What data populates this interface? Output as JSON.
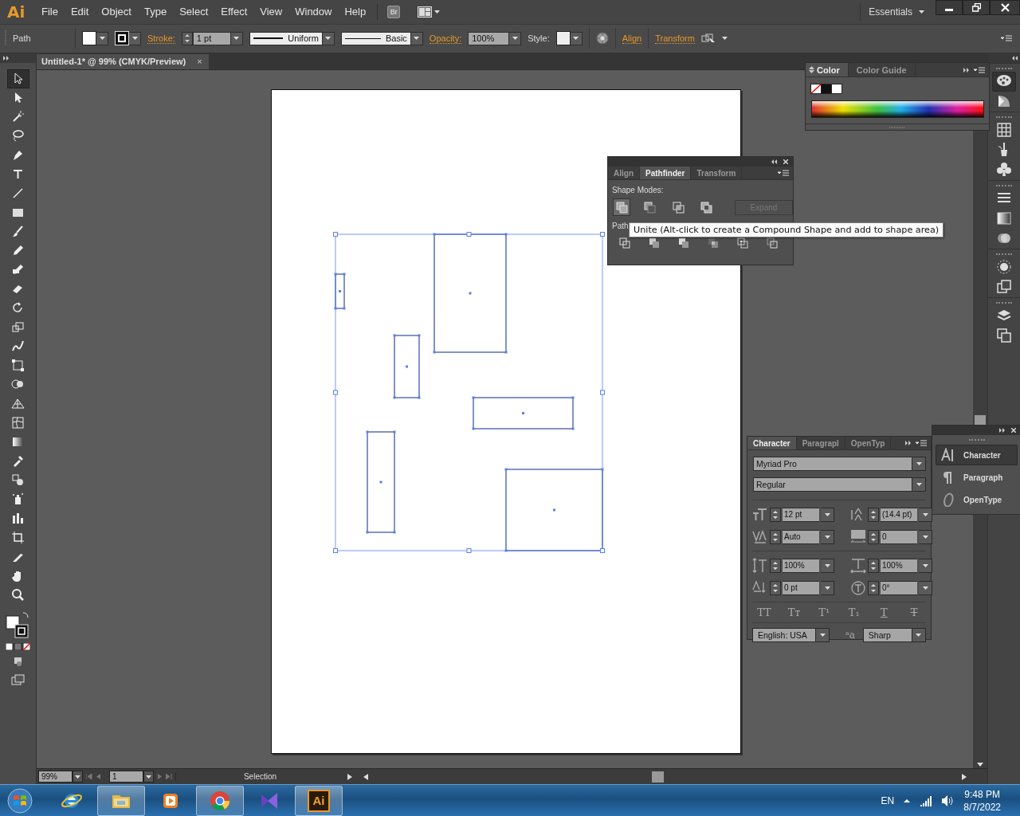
{
  "app": {
    "logo": "Ai",
    "menu": [
      "File",
      "Edit",
      "Object",
      "Type",
      "Select",
      "Effect",
      "View",
      "Window",
      "Help"
    ],
    "bridge": "Br",
    "workspace": "Essentials"
  },
  "control_bar": {
    "selection": "Path",
    "stroke_label": "Stroke:",
    "stroke_weight": "1 pt",
    "profile": "Uniform",
    "brush": "Basic",
    "opacity_label": "Opacity:",
    "opacity": "100%",
    "style_label": "Style:",
    "links": [
      "Align",
      "Transform"
    ]
  },
  "document_tab": {
    "title": "Untitled-1* @ 99% (CMYK/Preview)",
    "close": "×"
  },
  "color_panel": {
    "tabs": [
      {
        "label": "Color",
        "selected": true
      },
      {
        "label": "Color Guide",
        "selected": false
      }
    ]
  },
  "pathfinder_panel": {
    "tabs": [
      {
        "label": "Align",
        "selected": false
      },
      {
        "label": "Pathfinder",
        "selected": true
      },
      {
        "label": "Transform",
        "selected": false
      }
    ],
    "shape_modes_label": "Shape Modes:",
    "shape_modes": [
      {
        "hovered": true
      },
      {
        "hovered": false
      },
      {
        "hovered": false
      },
      {
        "hovered": false
      }
    ],
    "expand": {
      "label": "Expand",
      "disabled": true
    },
    "pathfinders_label": "Path",
    "tooltip": "Unite (Alt-click to create a Compound Shape and add to shape area)"
  },
  "character_panel": {
    "tabs": [
      {
        "label": "Character",
        "selected": true
      },
      {
        "label": "Paragrapl",
        "selected": false
      },
      {
        "label": "OpenTyp",
        "selected": false
      }
    ],
    "font": "Myriad Pro",
    "style": "Regular",
    "metrics": [
      {
        "value": "12 pt"
      },
      {
        "value": "(14.4 pt)"
      },
      {
        "value": "Auto"
      },
      {
        "value": "0"
      },
      {
        "value": "100%"
      },
      {
        "value": "100%"
      },
      {
        "value": "0 pt"
      },
      {
        "value": "0°"
      }
    ],
    "type_buttons": [
      {
        "label": "TT",
        "kind": "plain"
      },
      {
        "label": "Tᴛ",
        "kind": "plain"
      },
      {
        "label": "T¹",
        "kind": "plain"
      },
      {
        "label": "T₁",
        "kind": "plain"
      },
      {
        "label": "T",
        "kind": "underline"
      },
      {
        "label": "T",
        "kind": "strike"
      }
    ],
    "language": "English: USA",
    "antialias_glyph": "ᵃa",
    "antialias": "Sharp"
  },
  "panel_dock": {
    "items": [
      {
        "label": "Character",
        "selected": true
      },
      {
        "label": "Paragraph",
        "selected": false
      },
      {
        "label": "OpenType",
        "selected": false
      }
    ]
  },
  "status_bar": {
    "zoom": "99%",
    "artboard": "1",
    "tool": "Selection"
  },
  "taskbar": {
    "apps": [
      {
        "kind": "browser",
        "running": false
      },
      {
        "kind": "folder",
        "running": true
      },
      {
        "kind": "media",
        "running": false
      },
      {
        "kind": "chrome",
        "running": true
      },
      {
        "kind": "studio",
        "running": false
      },
      {
        "kind": "illustrator",
        "running": true,
        "label": "Ai"
      }
    ],
    "language": "EN",
    "time": "9:48 PM",
    "date": "8/7/2022"
  }
}
